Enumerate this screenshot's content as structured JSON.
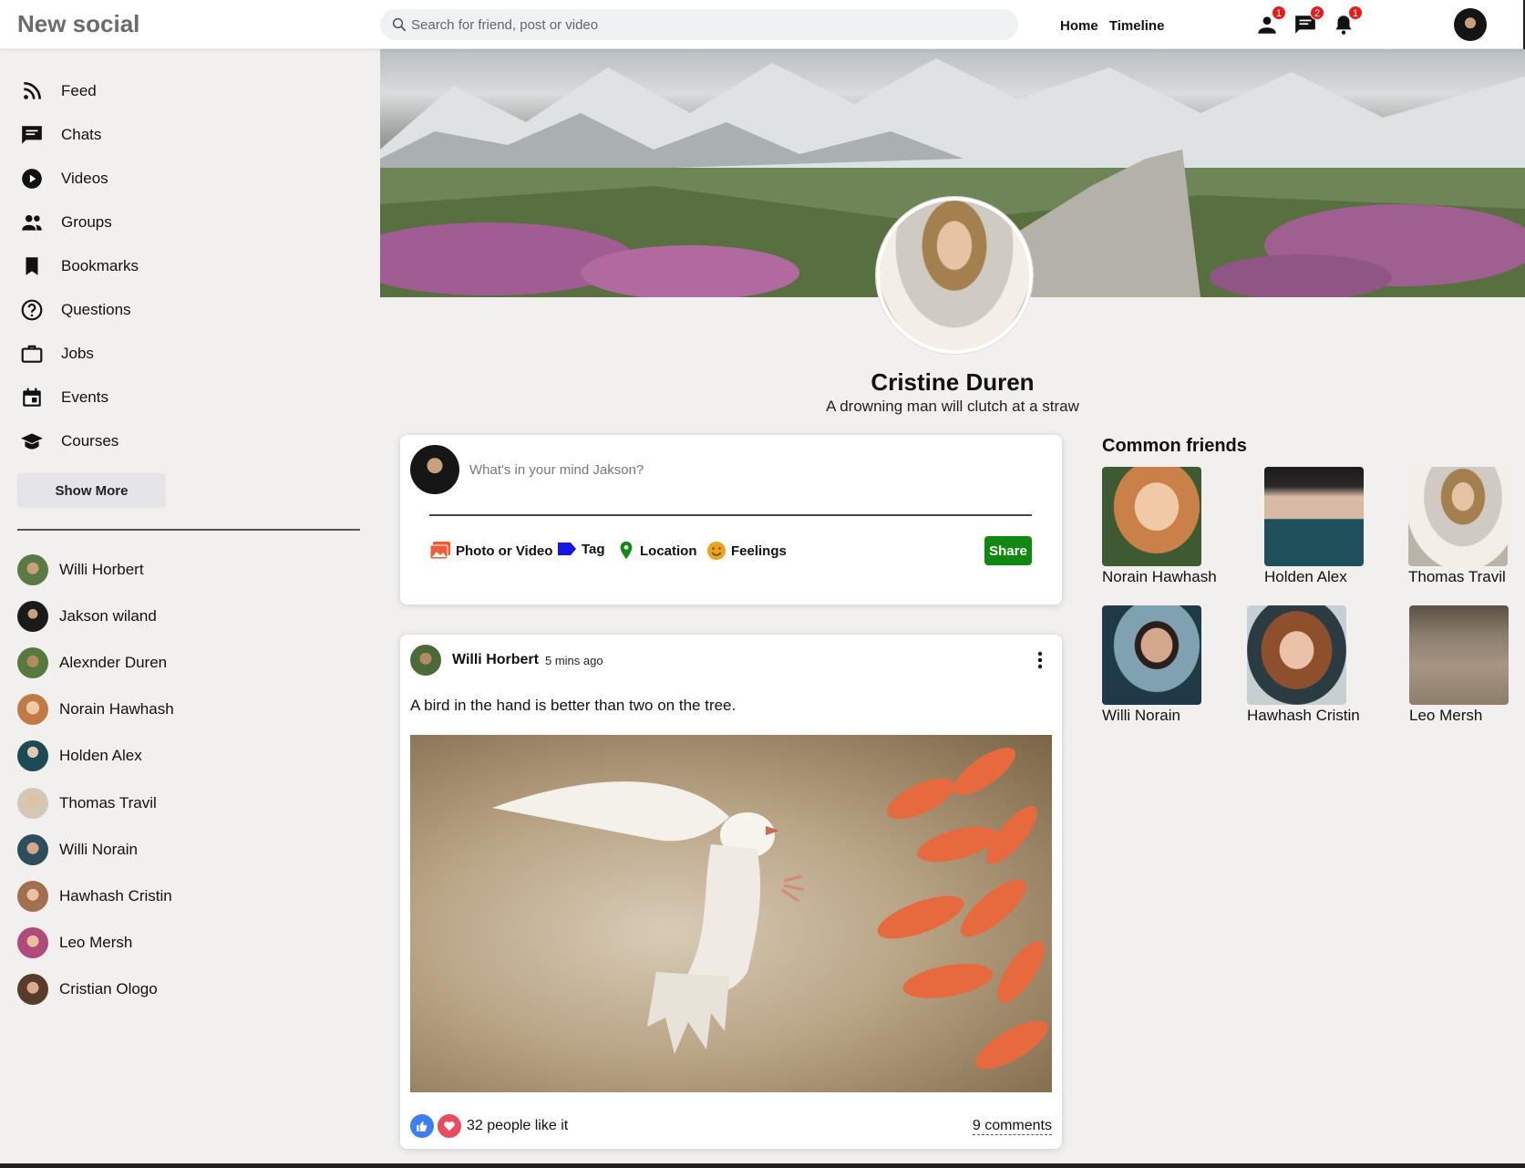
{
  "app": {
    "logo": "New social"
  },
  "topbar": {
    "search_placeholder": "Search for friend, post or video",
    "links": [
      "Home",
      "Timeline"
    ],
    "badges": {
      "friends": "1",
      "messages": "2",
      "notifications": "1"
    }
  },
  "sidebar": {
    "items": [
      {
        "label": "Feed",
        "icon": "rss-icon"
      },
      {
        "label": "Chats",
        "icon": "chat-icon"
      },
      {
        "label": "Videos",
        "icon": "play-circle-icon"
      },
      {
        "label": "Groups",
        "icon": "group-icon"
      },
      {
        "label": "Bookmarks",
        "icon": "bookmark-icon"
      },
      {
        "label": "Questions",
        "icon": "help-circle-icon"
      },
      {
        "label": "Jobs",
        "icon": "briefcase-icon"
      },
      {
        "label": "Events",
        "icon": "calendar-icon"
      },
      {
        "label": "Courses",
        "icon": "school-icon"
      }
    ],
    "show_more": "Show More",
    "friends": [
      {
        "name": "Willi Horbert",
        "color": "#5b7a43"
      },
      {
        "name": "Jakson wiland",
        "color": "#1a1a1a"
      },
      {
        "name": "Alexnder Duren",
        "color": "#567a3e"
      },
      {
        "name": "Norain Hawhash",
        "color": "#c07a45"
      },
      {
        "name": "Holden Alex",
        "color": "#1d4b55"
      },
      {
        "name": "Thomas Travil",
        "color": "#d4c7b4"
      },
      {
        "name": "Willi Norain",
        "color": "#2e4e5e"
      },
      {
        "name": "Hawhash Cristin",
        "color": "#a0704f"
      },
      {
        "name": "Leo Mersh",
        "color": "#b04a7a"
      },
      {
        "name": "Cristian Ologo",
        "color": "#5a3a2a"
      }
    ]
  },
  "profile": {
    "name": "Cristine Duren",
    "bio": "A drowning man will clutch at a straw"
  },
  "composer": {
    "placeholder": "What's in your mind Jakson?",
    "options": [
      {
        "label": "Photo or Video",
        "icon": "photo-icon",
        "color": "#f05a35"
      },
      {
        "label": "Tag",
        "icon": "tag-icon",
        "color": "#1515e6"
      },
      {
        "label": "Location",
        "icon": "location-pin-icon",
        "color": "#118811"
      },
      {
        "label": "Feelings",
        "icon": "emoji-icon",
        "color": "#e9a31c"
      }
    ],
    "share": "Share"
  },
  "post": {
    "author": "Willi Horbert",
    "time": "5 mins ago",
    "text": "A bird in the hand is better than two on the tree.",
    "likes": "32 people like it",
    "comments": "9 comments"
  },
  "common_friends": {
    "title": "Common friends",
    "people": [
      {
        "name": "Norain Hawhash",
        "color": "#b9764a"
      },
      {
        "name": "Holden Alex",
        "color": "#1f4f5a"
      },
      {
        "name": "Thomas Travil",
        "color": "#d8cfc0"
      },
      {
        "name": "Willi Norain",
        "color": "#2f5463"
      },
      {
        "name": "Hawhash Cristin",
        "color": "#a1643f"
      },
      {
        "name": "Leo Mersh",
        "color": "#9c8f7d"
      }
    ]
  }
}
